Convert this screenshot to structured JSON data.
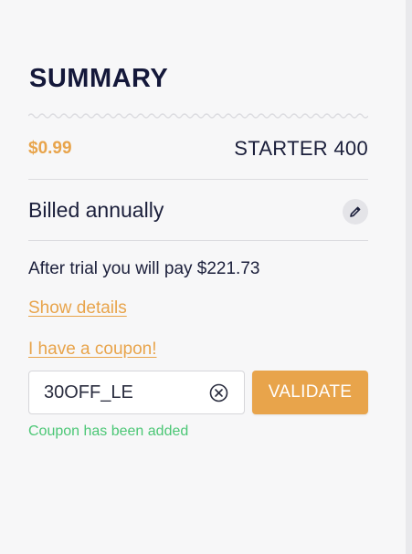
{
  "summary": {
    "title": "SUMMARY",
    "price": "$0.99",
    "plan_name": "STARTER 400",
    "billing_period": "Billed annually",
    "after_trial_text": "After trial you will pay $221.73",
    "show_details_label": "Show details",
    "coupon_link_label": "I have a coupon!",
    "coupon": {
      "value": "30OFF_LE",
      "validate_label": "VALIDATE",
      "status_message": "Coupon has been added"
    }
  },
  "icons": {
    "edit": "pencil-icon",
    "clear": "clear-circle-icon"
  },
  "colors": {
    "accent": "#e8a44b",
    "title": "#14183a",
    "text": "#1b1f3b",
    "success": "#4cc776",
    "panel_background": "#f7f7f8"
  }
}
